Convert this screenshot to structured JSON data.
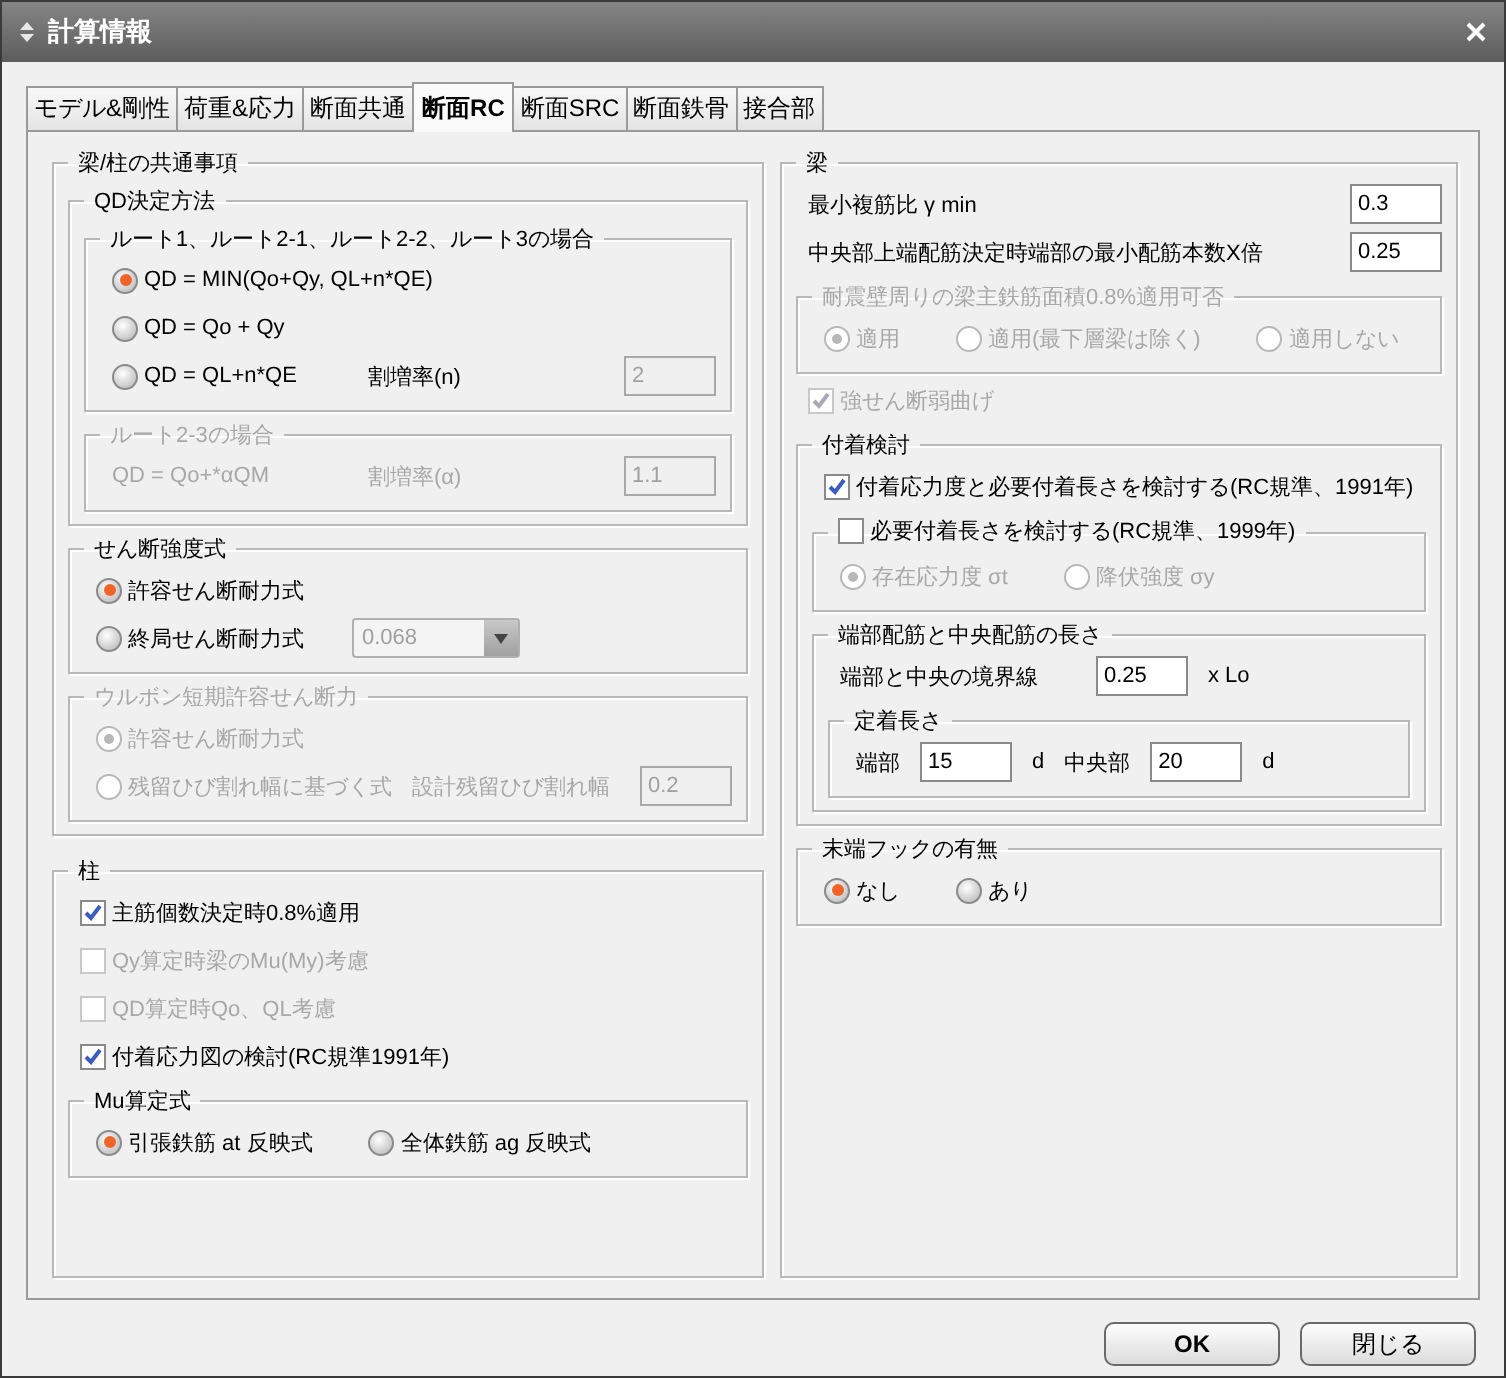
{
  "window": {
    "title": "計算情報"
  },
  "tabs": [
    {
      "label": "モデル&剛性",
      "selected": false
    },
    {
      "label": "荷重&応力",
      "selected": false
    },
    {
      "label": "断面共通",
      "selected": false
    },
    {
      "label": "断面RC",
      "selected": true
    },
    {
      "label": "断面SRC",
      "selected": false
    },
    {
      "label": "断面鉄骨",
      "selected": false
    },
    {
      "label": "接合部",
      "selected": false
    }
  ],
  "left_panel": [
    {
      "kind": "group",
      "title": "梁/柱の共通事項",
      "disabled": false,
      "children": [
        {
          "kind": "group",
          "title": "QD決定方法",
          "disabled": false,
          "children": [
            {
              "kind": "group",
              "title": "ルート1、ルート2-1、ルート2-2、ルート3の場合",
              "disabled": false,
              "children": [
                {
                  "kind": "row",
                  "items": [
                    {
                      "kind": "radio",
                      "label": "QD = MIN(Qo+Qy, QL+n*QE)",
                      "selected": true,
                      "disabled": false
                    }
                  ]
                },
                {
                  "kind": "row",
                  "items": [
                    {
                      "kind": "radio",
                      "label": "QD = Qo + Qy",
                      "selected": false,
                      "disabled": false
                    }
                  ]
                },
                {
                  "kind": "row",
                  "items": [
                    {
                      "kind": "radio",
                      "label": "QD = QL+n*QE",
                      "selected": false,
                      "disabled": false
                    },
                    {
                      "kind": "label",
                      "text": "割増率(n)",
                      "disabled": false
                    },
                    {
                      "kind": "field",
                      "value": "2",
                      "disabled": true
                    }
                  ]
                }
              ]
            },
            {
              "kind": "group",
              "title": "ルート2-3の場合",
              "disabled": true,
              "children": [
                {
                  "kind": "row",
                  "items": [
                    {
                      "kind": "label",
                      "text": "QD = Qo+*αQM",
                      "disabled": true
                    },
                    {
                      "kind": "label",
                      "text": "割増率(α)",
                      "disabled": true
                    },
                    {
                      "kind": "field",
                      "value": "1.1",
                      "disabled": true
                    }
                  ]
                }
              ]
            }
          ]
        },
        {
          "kind": "group",
          "title": "せん断強度式",
          "disabled": false,
          "children": [
            {
              "kind": "row",
              "items": [
                {
                  "kind": "radio",
                  "label": "許容せん断耐力式",
                  "selected": true,
                  "disabled": false
                }
              ]
            },
            {
              "kind": "row",
              "items": [
                {
                  "kind": "radio",
                  "label": "終局せん断耐力式",
                  "selected": false,
                  "disabled": false
                },
                {
                  "kind": "select",
                  "value": "0.068",
                  "disabled": true
                }
              ]
            }
          ]
        },
        {
          "kind": "group",
          "title": "ウルボン短期許容せん断力",
          "disabled": true,
          "children": [
            {
              "kind": "row",
              "items": [
                {
                  "kind": "radio",
                  "label": "許容せん断耐力式",
                  "selected": true,
                  "disabled": true
                }
              ]
            },
            {
              "kind": "row",
              "items": [
                {
                  "kind": "radio",
                  "label": "残留ひび割れ幅に基づく式",
                  "selected": false,
                  "disabled": true
                },
                {
                  "kind": "label",
                  "text": "設計残留ひび割れ幅",
                  "disabled": true
                },
                {
                  "kind": "field",
                  "value": "0.2",
                  "disabled": true
                }
              ]
            }
          ]
        }
      ]
    },
    {
      "kind": "group",
      "title": "柱",
      "disabled": false,
      "children": [
        {
          "kind": "row",
          "items": [
            {
              "kind": "checkbox",
              "label": "主筋個数決定時0.8%適用",
              "checked": true,
              "disabled": false
            }
          ]
        },
        {
          "kind": "row",
          "items": [
            {
              "kind": "checkbox",
              "label": "Qy算定時梁のMu(My)考慮",
              "checked": false,
              "disabled": true
            }
          ]
        },
        {
          "kind": "row",
          "items": [
            {
              "kind": "checkbox",
              "label": "QD算定時Qo、QL考慮",
              "checked": false,
              "disabled": true
            }
          ]
        },
        {
          "kind": "row",
          "items": [
            {
              "kind": "checkbox",
              "label": "付着応力図の検討(RC規準1991年)",
              "checked": true,
              "disabled": false
            }
          ]
        },
        {
          "kind": "group",
          "title": "Mu算定式",
          "disabled": false,
          "children": [
            {
              "kind": "row",
              "items": [
                {
                  "kind": "radio",
                  "label": "引張鉄筋 at 反映式",
                  "selected": true,
                  "disabled": false
                },
                {
                  "kind": "radio",
                  "label": "全体鉄筋 ag 反映式",
                  "selected": false,
                  "disabled": false
                }
              ]
            }
          ]
        }
      ]
    }
  ],
  "right_panel": [
    {
      "kind": "group",
      "title": "梁",
      "disabled": false,
      "children": [
        {
          "kind": "row",
          "items": [
            {
              "kind": "label",
              "text": "最小複筋比 γ min",
              "disabled": false
            },
            {
              "kind": "field",
              "value": "0.3",
              "disabled": false
            }
          ]
        },
        {
          "kind": "row",
          "items": [
            {
              "kind": "label",
              "text": "中央部上端配筋決定時端部の最小配筋本数X倍",
              "disabled": false
            },
            {
              "kind": "field",
              "value": "0.25",
              "disabled": false
            }
          ]
        },
        {
          "kind": "group",
          "title": "耐震壁周りの梁主鉄筋面積0.8%適用可否",
          "disabled": true,
          "children": [
            {
              "kind": "row",
              "items": [
                {
                  "kind": "radio",
                  "label": "適用",
                  "selected": true,
                  "disabled": true
                },
                {
                  "kind": "radio",
                  "label": "適用(最下層梁は除く)",
                  "selected": false,
                  "disabled": true
                },
                {
                  "kind": "radio",
                  "label": "適用しない",
                  "selected": false,
                  "disabled": true
                }
              ]
            }
          ]
        },
        {
          "kind": "row",
          "items": [
            {
              "kind": "checkbox",
              "label": "強せん断弱曲げ",
              "checked": true,
              "disabled": true
            }
          ]
        },
        {
          "kind": "group",
          "title": "付着検討",
          "disabled": false,
          "children": [
            {
              "kind": "row",
              "items": [
                {
                  "kind": "checkbox",
                  "label": "付着応力度と必要付着長さを検討する(RC規準、1991年)",
                  "checked": true,
                  "disabled": false
                }
              ]
            },
            {
              "kind": "checkgroup",
              "title": "必要付着長さを検討する(RC規準、1999年)",
              "checked": false,
              "disabled": false,
              "children": [
                {
                  "kind": "row",
                  "items": [
                    {
                      "kind": "radio",
                      "label": "存在応力度 σt",
                      "selected": true,
                      "disabled": true
                    },
                    {
                      "kind": "radio",
                      "label": "降伏強度 σy",
                      "selected": false,
                      "disabled": true
                    }
                  ]
                }
              ]
            },
            {
              "kind": "group",
              "title": "端部配筋と中央配筋の長さ",
              "disabled": false,
              "children": [
                {
                  "kind": "row",
                  "items": [
                    {
                      "kind": "label",
                      "text": "端部と中央の境界線",
                      "disabled": false
                    },
                    {
                      "kind": "field",
                      "value": "0.25",
                      "disabled": false
                    },
                    {
                      "kind": "label",
                      "text": "x Lo",
                      "disabled": false
                    }
                  ]
                },
                {
                  "kind": "group",
                  "title": "定着長さ",
                  "disabled": false,
                  "children": [
                    {
                      "kind": "row",
                      "items": [
                        {
                          "kind": "label",
                          "text": "端部",
                          "disabled": false
                        },
                        {
                          "kind": "field",
                          "value": "15",
                          "disabled": false
                        },
                        {
                          "kind": "label",
                          "text": "d",
                          "disabled": false
                        },
                        {
                          "kind": "label",
                          "text": "中央部",
                          "disabled": false
                        },
                        {
                          "kind": "field",
                          "value": "20",
                          "disabled": false
                        },
                        {
                          "kind": "label",
                          "text": "d",
                          "disabled": false
                        }
                      ]
                    }
                  ]
                }
              ]
            }
          ]
        },
        {
          "kind": "group",
          "title": "末端フックの有無",
          "disabled": false,
          "children": [
            {
              "kind": "row",
              "items": [
                {
                  "kind": "radio",
                  "label": "なし",
                  "selected": true,
                  "disabled": false
                },
                {
                  "kind": "radio",
                  "label": "あり",
                  "selected": false,
                  "disabled": false
                }
              ]
            }
          ]
        }
      ]
    }
  ],
  "buttons": [
    {
      "label": "OK",
      "kind": "default"
    },
    {
      "label": "閉じる",
      "kind": "normal"
    }
  ]
}
